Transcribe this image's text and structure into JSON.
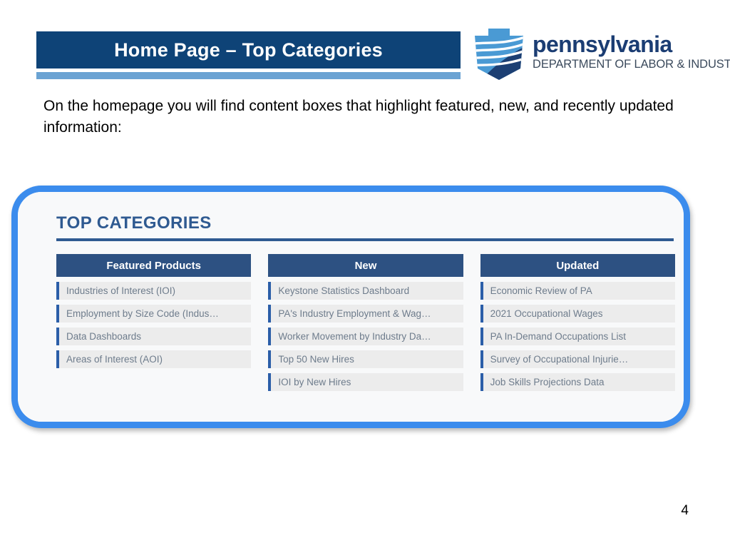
{
  "slide": {
    "title": "Home Page – Top Categories",
    "body_text": "On the homepage you will find content boxes that highlight featured, new, and recently updated information:",
    "page_number": "4"
  },
  "logo": {
    "icon": "pennsylvania-keystone-icon",
    "wordmark": "pennsylvania",
    "subtitle": "DEPARTMENT OF LABOR & INDUSTRY"
  },
  "card": {
    "heading": "TOP CATEGORIES",
    "columns": [
      {
        "header": "Featured Products",
        "items": [
          "Industries of Interest (IOI)",
          "Employment by Size Code (Indus…",
          "Data Dashboards",
          "Areas of Interest (AOI)"
        ]
      },
      {
        "header": "New",
        "items": [
          "Keystone Statistics Dashboard",
          "PA's Industry Employment & Wag…",
          "Worker Movement by Industry Da…",
          "Top 50 New Hires",
          "IOI by New Hires"
        ]
      },
      {
        "header": "Updated",
        "items": [
          "Economic Review of PA",
          "2021 Occupational Wages",
          "PA In-Demand Occupations List",
          "Survey of Occupational Injurie…",
          "Job Skills Projections Data"
        ]
      }
    ]
  },
  "colors": {
    "banner_navy": "#0e4377",
    "banner_underline_blue": "#6ba3d3",
    "card_border_blue": "#3b8ced",
    "column_header_navy": "#2d5182",
    "item_accent_blue": "#2b5ea8",
    "heading_blue": "#2f5a91"
  }
}
